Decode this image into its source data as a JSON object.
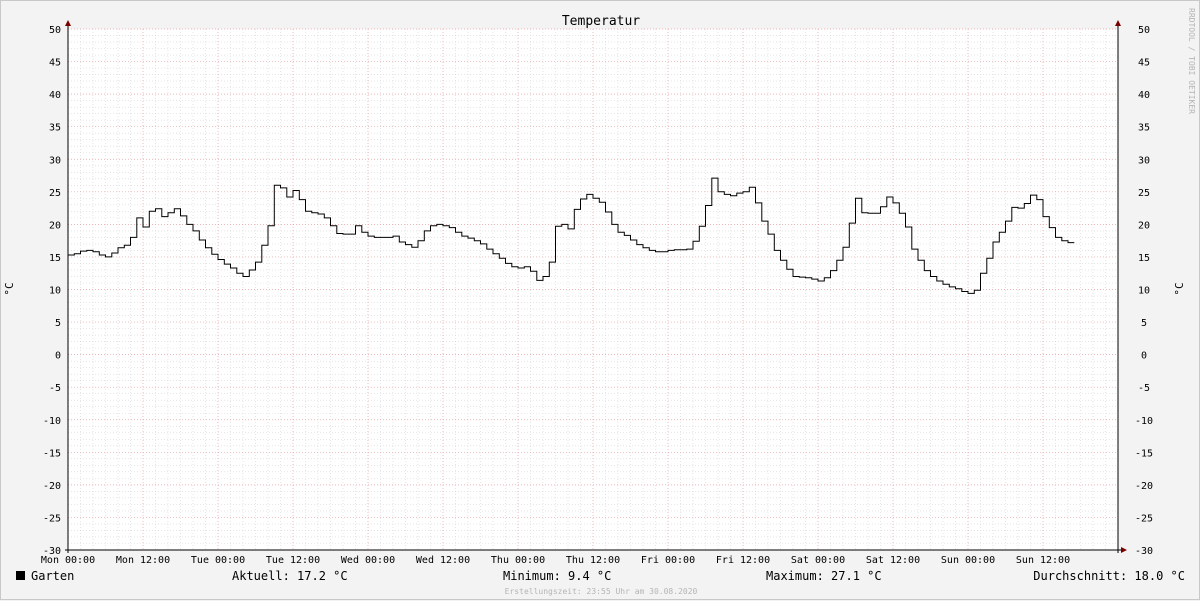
{
  "chart_data": {
    "type": "line",
    "title": "Temperatur",
    "ylabel_left": "°C",
    "ylabel_right": "°C",
    "ylim": [
      -30,
      50
    ],
    "y_ticks": [
      50,
      45,
      40,
      35,
      30,
      25,
      20,
      15,
      10,
      5,
      0,
      -5,
      -10,
      -15,
      -20,
      -25,
      -30
    ],
    "xlim_hours": [
      0,
      168
    ],
    "x_ticks": [
      {
        "hour": 0,
        "label": "Mon 00:00"
      },
      {
        "hour": 12,
        "label": "Mon 12:00"
      },
      {
        "hour": 24,
        "label": "Tue 00:00"
      },
      {
        "hour": 36,
        "label": "Tue 12:00"
      },
      {
        "hour": 48,
        "label": "Wed 00:00"
      },
      {
        "hour": 60,
        "label": "Wed 12:00"
      },
      {
        "hour": 72,
        "label": "Thu 00:00"
      },
      {
        "hour": 84,
        "label": "Thu 12:00"
      },
      {
        "hour": 96,
        "label": "Fri 00:00"
      },
      {
        "hour": 108,
        "label": "Fri 12:00"
      },
      {
        "hour": 120,
        "label": "Sat 00:00"
      },
      {
        "hour": 132,
        "label": "Sat 12:00"
      },
      {
        "hour": 144,
        "label": "Sun 00:00"
      },
      {
        "hour": 156,
        "label": "Sun 12:00"
      }
    ],
    "grid": true,
    "series": [
      {
        "name": "Garten",
        "color": "#000000",
        "step": true,
        "x_hours": [
          0,
          1,
          2,
          3,
          4,
          5,
          6,
          7,
          8,
          9,
          10,
          11,
          12,
          13,
          14,
          15,
          16,
          17,
          18,
          19,
          20,
          21,
          22,
          23,
          24,
          25,
          26,
          27,
          28,
          29,
          30,
          31,
          32,
          33,
          34,
          35,
          36,
          37,
          38,
          39,
          40,
          41,
          42,
          43,
          44,
          45,
          46,
          47,
          48,
          49,
          50,
          51,
          52,
          53,
          54,
          55,
          56,
          57,
          58,
          59,
          60,
          61,
          62,
          63,
          64,
          65,
          66,
          67,
          68,
          69,
          70,
          71,
          72,
          73,
          74,
          75,
          76,
          77,
          78,
          79,
          80,
          81,
          82,
          83,
          84,
          85,
          86,
          87,
          88,
          89,
          90,
          91,
          92,
          93,
          94,
          95,
          96,
          97,
          98,
          99,
          100,
          101,
          102,
          103,
          104,
          105,
          106,
          107,
          108,
          109,
          110,
          111,
          112,
          113,
          114,
          115,
          116,
          117,
          118,
          119,
          120,
          121,
          122,
          123,
          124,
          125,
          126,
          127,
          128,
          129,
          130,
          131,
          132,
          133,
          134,
          135,
          136,
          137,
          138,
          139,
          140,
          141,
          142,
          143,
          144,
          145,
          146,
          147,
          148,
          149,
          150,
          151,
          152,
          153,
          154,
          155,
          156,
          157,
          158,
          159,
          160,
          161,
          162,
          163,
          164,
          165,
          166,
          167
        ],
        "values": [
          15.3,
          15.5,
          15.9,
          16.0,
          15.8,
          15.3,
          15.0,
          15.6,
          16.4,
          16.8,
          18.0,
          21.0,
          19.6,
          22.0,
          22.4,
          21.2,
          21.8,
          22.4,
          21.3,
          20.0,
          19.0,
          17.6,
          16.4,
          15.4,
          14.6,
          13.9,
          13.3,
          12.5,
          12.0,
          13.0,
          14.2,
          16.8,
          19.8,
          26.0,
          25.6,
          24.2,
          25.2,
          23.8,
          22.0,
          21.8,
          21.6,
          21.0,
          19.8,
          18.6,
          18.5,
          18.5,
          19.8,
          18.8,
          18.2,
          18.0,
          18.0,
          18.0,
          18.2,
          17.3,
          16.9,
          16.5,
          17.5,
          19.0,
          19.8,
          20.0,
          19.8,
          19.5,
          18.8,
          18.2,
          17.9,
          17.5,
          17.0,
          16.2,
          15.5,
          14.8,
          14.0,
          13.5,
          13.3,
          13.5,
          12.8,
          11.4,
          12.0,
          14.2,
          19.7,
          20.0,
          19.3,
          22.3,
          23.9,
          24.6,
          24.0,
          23.4,
          21.9,
          20.0,
          18.8,
          18.3,
          17.6,
          16.9,
          16.4,
          16.0,
          15.8,
          15.8,
          16.0,
          16.1,
          16.1,
          16.2,
          17.4,
          19.7,
          22.9,
          27.1,
          25.0,
          24.6,
          24.4,
          24.8,
          25.0,
          25.7,
          23.3,
          20.5,
          18.5,
          16.0,
          14.5,
          13.1,
          12.0,
          11.9,
          11.8,
          11.6,
          11.3,
          11.8,
          12.9,
          14.5,
          16.5,
          20.2,
          24.0,
          21.8,
          21.7,
          21.7,
          22.7,
          24.2,
          23.3,
          21.7,
          19.6,
          16.2,
          14.5,
          12.9,
          12.0,
          11.3,
          10.8,
          10.4,
          10.1,
          9.7,
          9.4,
          9.9,
          12.5,
          14.8,
          17.3,
          18.8,
          20.5,
          22.6,
          22.5,
          23.2,
          24.5,
          23.8,
          21.2,
          19.5,
          18.0,
          17.5,
          17.2
        ]
      }
    ]
  },
  "legend": {
    "series_name": "Garten",
    "current": "Aktuell: 17.2 °C",
    "minimum": "Minimum: 9.4 °C",
    "maximum": "Maximum: 27.1 °C",
    "average": "Durchschnitt: 18.0 °C"
  },
  "footer": {
    "creation_time": "Erstellungszeit: 23:55 Uhr am 30.08.2020"
  },
  "watermark": "RRDTOOL / TOBI OETIKER",
  "colors": {
    "background": "#f3f3f3",
    "plot_background": "#ffffff",
    "major_grid": "#e8a0a0",
    "minor_grid": "#d6d6d6",
    "axis": "#7a0000",
    "line": "#000000"
  }
}
